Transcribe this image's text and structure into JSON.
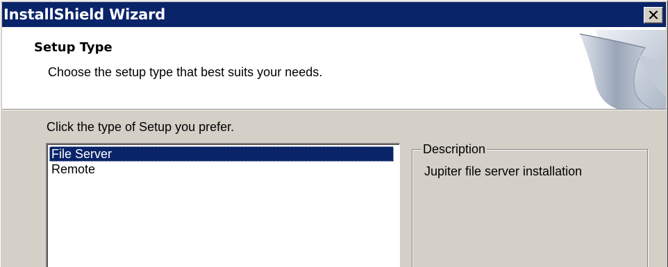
{
  "window": {
    "title": "InstallShield Wizard",
    "close_icon": "close-x-icon"
  },
  "header": {
    "title": "Setup Type",
    "subtitle": "Choose the setup type that best suits your needs.",
    "art_icon": "page-curl-graphic"
  },
  "body": {
    "prompt": "Click the type of Setup you prefer.",
    "setup_types": [
      {
        "label": "File Server",
        "selected": true
      },
      {
        "label": "Remote",
        "selected": false
      }
    ],
    "description": {
      "label": "Description",
      "text": "Jupiter file server installation"
    }
  },
  "colors": {
    "titlebar": "#0a246a",
    "face": "#d4d0c8",
    "selection": "#0a246a"
  }
}
